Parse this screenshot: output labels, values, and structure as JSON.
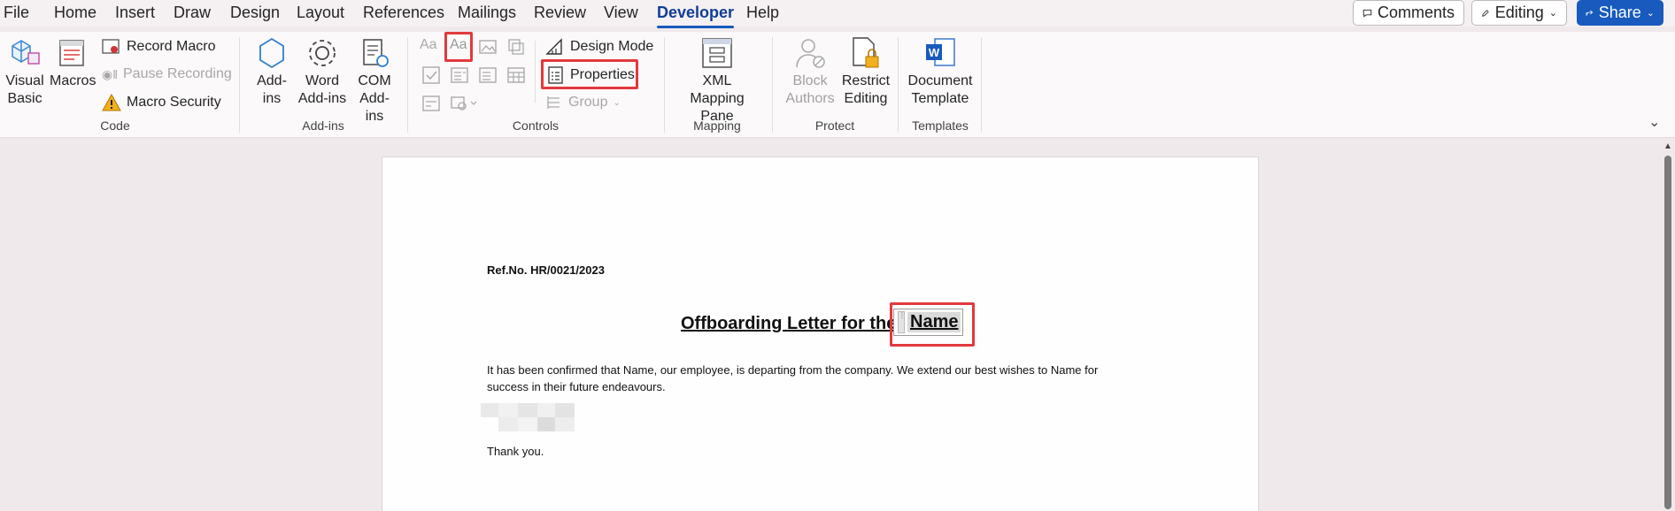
{
  "menu": {
    "tabs": [
      "File",
      "Home",
      "Insert",
      "Draw",
      "Design",
      "Layout",
      "References",
      "Mailings",
      "Review",
      "View",
      "Developer",
      "Help"
    ],
    "active_tab": "Developer",
    "comments_label": "Comments",
    "editing_label": "Editing",
    "share_label": "Share"
  },
  "ribbon": {
    "code": {
      "label": "Code",
      "visual_basic": "Visual Basic",
      "macros": "Macros",
      "record_macro": "Record Macro",
      "pause_recording": "Pause Recording",
      "macro_security": "Macro Security"
    },
    "addins": {
      "label": "Add-ins",
      "addins": "Add-ins",
      "word_addins": "Word Add-ins",
      "com_addins": "COM Add-ins"
    },
    "controls": {
      "label": "Controls",
      "design_mode": "Design Mode",
      "properties": "Properties",
      "group": "Group"
    },
    "mapping": {
      "label": "Mapping",
      "xml_mapping_pane": "XML Mapping Pane"
    },
    "protect": {
      "label": "Protect",
      "block_authors": "Block Authors",
      "restrict_editing": "Restrict Editing"
    },
    "templates": {
      "label": "Templates",
      "document_template": "Document Template"
    }
  },
  "document": {
    "ref_no": "Ref.No. HR/0021/2023",
    "title_prefix": "Offboarding Letter for the",
    "name_field": "Name",
    "body_line1": "It has been confirmed that Name, our employee, is departing from the company. We extend our best wishes to Name for",
    "body_line2": "success in their future endeavours.",
    "closing": "Thank you."
  },
  "colors": {
    "accent": "#185abd",
    "highlight_box": "#e2393d",
    "active_tab": "#0f3e96"
  }
}
